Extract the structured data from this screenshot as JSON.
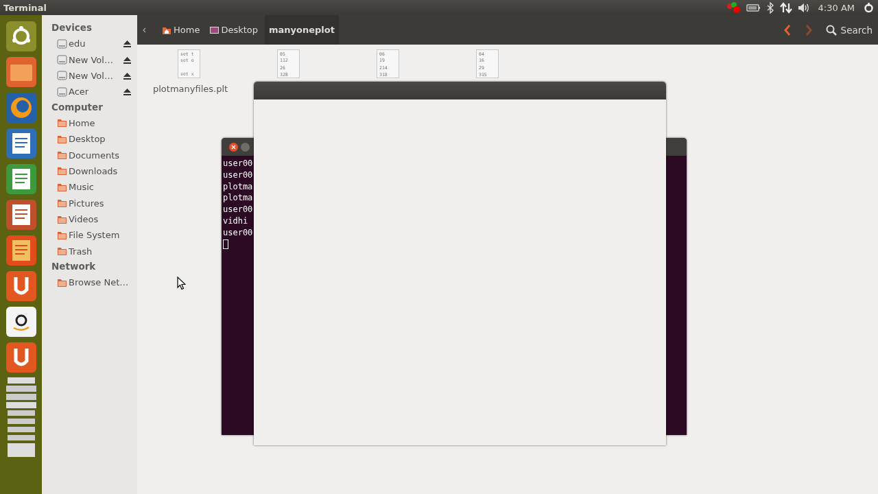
{
  "top_bar": {
    "title": "Terminal",
    "clock": "4:30 AM"
  },
  "sidebar": {
    "sections": [
      {
        "title": "Devices",
        "kind": "devices",
        "items": [
          {
            "label": "edu",
            "eject": true
          },
          {
            "label": "New Vol…",
            "eject": true
          },
          {
            "label": "New Vol…",
            "eject": true
          },
          {
            "label": "Acer",
            "eject": true
          }
        ]
      },
      {
        "title": "Computer",
        "kind": "places",
        "items": [
          {
            "label": "Home"
          },
          {
            "label": "Desktop"
          },
          {
            "label": "Documents"
          },
          {
            "label": "Downloads"
          },
          {
            "label": "Music"
          },
          {
            "label": "Pictures"
          },
          {
            "label": "Videos"
          },
          {
            "label": "File System"
          },
          {
            "label": "Trash"
          }
        ]
      },
      {
        "title": "Network",
        "kind": "places",
        "items": [
          {
            "label": "Browse Net…"
          }
        ]
      }
    ]
  },
  "toolbar": {
    "breadcrumbs": [
      {
        "label": "Home",
        "selected": false
      },
      {
        "label": "Desktop",
        "selected": false
      },
      {
        "label": "manyoneplot",
        "selected": true
      }
    ],
    "search": "Search"
  },
  "files": [
    {
      "preview": [
        "set t",
        "set o",
        "set x"
      ],
      "name": "plotmanyfiles.plt"
    },
    {
      "preview": [
        "05",
        "112",
        "26",
        "328"
      ]
    },
    {
      "preview": [
        "06",
        "19",
        "214",
        "318"
      ]
    },
    {
      "preview": [
        "04",
        "16",
        "29",
        "315"
      ]
    }
  ],
  "terminal": {
    "lines": [
      "user00",
      "user00",
      "plotma",
      "plotma",
      "user00",
      "vidhi",
      "user00"
    ]
  }
}
